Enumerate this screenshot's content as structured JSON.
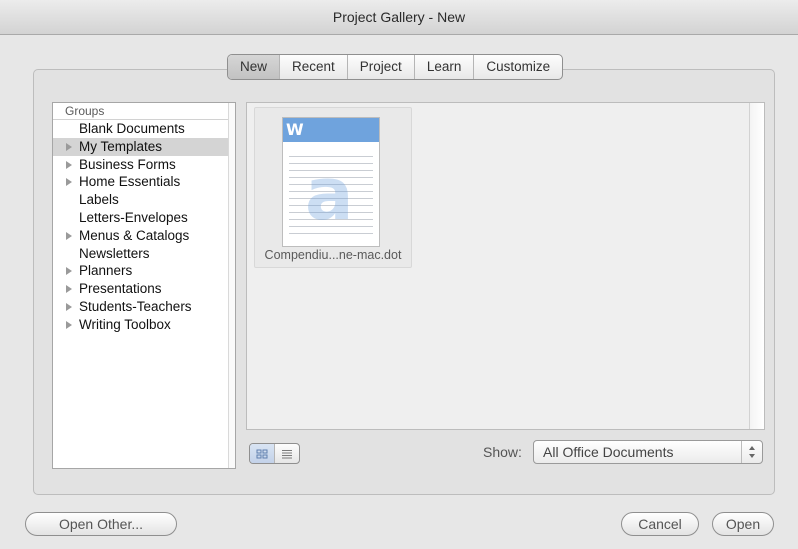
{
  "window": {
    "title": "Project Gallery - New"
  },
  "tabs": [
    {
      "label": "New",
      "active": true
    },
    {
      "label": "Recent",
      "active": false
    },
    {
      "label": "Project",
      "active": false
    },
    {
      "label": "Learn",
      "active": false
    },
    {
      "label": "Customize",
      "active": false
    }
  ],
  "groups": {
    "header": "Groups",
    "items": [
      {
        "label": "Blank Documents",
        "expandable": false,
        "selected": false
      },
      {
        "label": "My Templates",
        "expandable": true,
        "selected": true
      },
      {
        "label": "Business Forms",
        "expandable": true,
        "selected": false
      },
      {
        "label": "Home Essentials",
        "expandable": true,
        "selected": false
      },
      {
        "label": "Labels",
        "expandable": false,
        "selected": false
      },
      {
        "label": "Letters-Envelopes",
        "expandable": false,
        "selected": false
      },
      {
        "label": "Menus & Catalogs",
        "expandable": true,
        "selected": false
      },
      {
        "label": "Newsletters",
        "expandable": false,
        "selected": false
      },
      {
        "label": "Planners",
        "expandable": true,
        "selected": false
      },
      {
        "label": "Presentations",
        "expandable": true,
        "selected": false
      },
      {
        "label": "Students-Teachers",
        "expandable": true,
        "selected": false
      },
      {
        "label": "Writing Toolbox",
        "expandable": true,
        "selected": false
      }
    ]
  },
  "documents": [
    {
      "name": "Compendiu...ne-mac.dot",
      "icon": "word-document-icon"
    }
  ],
  "view": {
    "mode": "icon"
  },
  "show": {
    "label": "Show:",
    "value": "All Office Documents"
  },
  "buttons": {
    "open_other": "Open Other...",
    "cancel": "Cancel",
    "open": "Open"
  }
}
